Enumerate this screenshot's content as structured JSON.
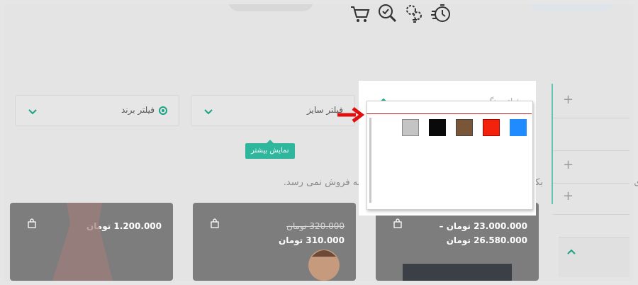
{
  "filters": [
    {
      "label": "فیلتر برند"
    },
    {
      "label": "فیلتر سایز"
    },
    {
      "label": "فیلتر رنگ"
    }
  ],
  "more_button": {
    "label": "نمایش بیشتر"
  },
  "notice": {
    "text": "بکس است. قیمت و مشخصات آن غیر واقعی و به فروش نمی رسد.",
    "first_char": "ای"
  },
  "products": [
    {
      "price": "1.200.000 تومان"
    },
    {
      "old_price": "320.000 تومان",
      "price": "310.000 تومان"
    },
    {
      "price": "23.000.000 تومان –",
      "price2": "26.580.000 تومان"
    }
  ],
  "color_swatches": [
    "#c4c4c4",
    "#0a0a0a",
    "#7a5638",
    "#f2220c",
    "#1f8bff"
  ],
  "accent_color": "#2fb79e",
  "top_icons": [
    "cart-icon",
    "search-check-icon",
    "gears-icon",
    "stopwatch-icon"
  ],
  "side_plus": [
    "+",
    "+",
    "+"
  ]
}
